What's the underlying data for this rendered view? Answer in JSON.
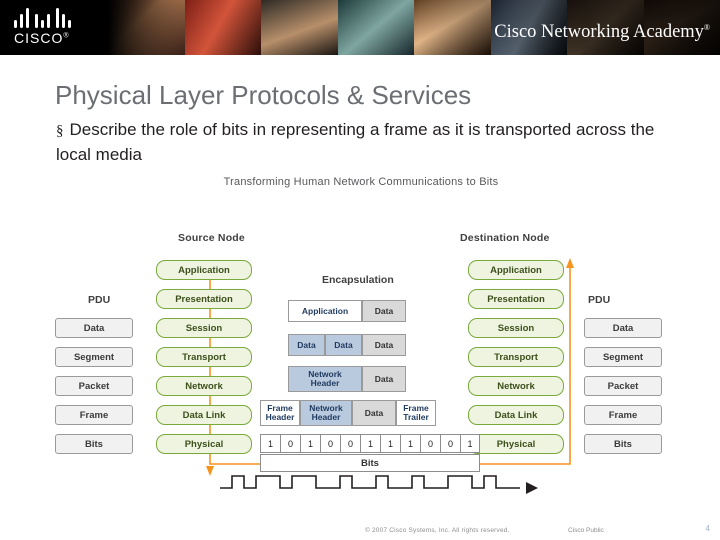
{
  "header": {
    "logo_word": "CISCO",
    "logo_tm": "®",
    "academy_text": "Cisco Networking Academy",
    "academy_tm": "®"
  },
  "slide": {
    "title": "Physical Layer Protocols & Services",
    "bullet_marker": "§",
    "bullet_text": "Describe the role of bits in representing a frame as it is transported across the local media"
  },
  "figure": {
    "title": "Transforming Human Network Communications to Bits",
    "source_node_label": "Source Node",
    "destination_node_label": "Destination Node",
    "pdu_label_left": "PDU",
    "pdu_label_right": "PDU",
    "encapsulation_label": "Encapsulation",
    "bits_caption": "Bits",
    "osi_layers": [
      "Application",
      "Presentation",
      "Session",
      "Transport",
      "Network",
      "Data Link",
      "Physical"
    ],
    "pdu_names": [
      "Data",
      "Segment",
      "Packet",
      "Frame",
      "Bits"
    ],
    "encapsulation_rows": [
      {
        "cells": [
          {
            "text": "Application",
            "style": "white"
          },
          {
            "text": "Data",
            "style": "gray"
          }
        ]
      },
      {
        "cells": [
          {
            "text": "Data",
            "style": "blue"
          },
          {
            "text": "Data",
            "style": "blue"
          },
          {
            "text": "Data",
            "style": "gray"
          }
        ]
      },
      {
        "cells": [
          {
            "text": "Network\nHeader",
            "style": "blue"
          },
          {
            "text": "Data",
            "style": "gray"
          }
        ]
      },
      {
        "cells": [
          {
            "text": "Frame\nHeader",
            "style": "white"
          },
          {
            "text": "Network\nHeader",
            "style": "blue"
          },
          {
            "text": "Data",
            "style": "gray"
          },
          {
            "text": "Frame\nTrailer",
            "style": "white"
          }
        ]
      }
    ],
    "bit_values": [
      "1",
      "0",
      "1",
      "0",
      "0",
      "1",
      "1",
      "1",
      "0",
      "0",
      "1"
    ]
  },
  "footer": {
    "copyright": "© 2007 Cisco Systems, Inc. All rights reserved.",
    "classification": "Cisco Public",
    "page_number": "4"
  },
  "colors": {
    "title_gray": "#6b6f73",
    "layer_green": "#7aa93c",
    "accent_orange": "#f7941e",
    "enc_blue": "#b9c9de"
  }
}
